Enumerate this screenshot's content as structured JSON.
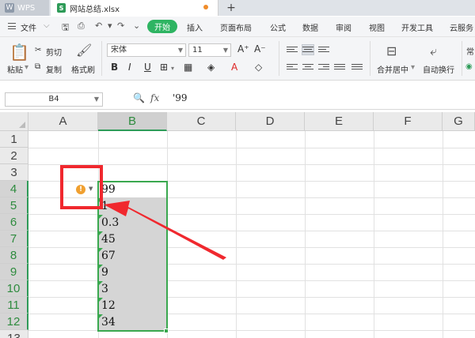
{
  "tabs": {
    "app_name": "WPS",
    "file_name": "网站总结.xlsx",
    "add": "+"
  },
  "menu": {
    "file": "文件",
    "start": "开始",
    "items": [
      "插入",
      "页面布局",
      "公式",
      "数据",
      "审阅",
      "视图",
      "开发工具",
      "云服务"
    ]
  },
  "ribbon": {
    "paste": "粘贴",
    "cut": "剪切",
    "copy": "复制",
    "format_painter": "格式刷",
    "font_name": "宋体",
    "font_size": "11",
    "merge_center": "合并居中",
    "wrap_text": "自动换行",
    "more": "常"
  },
  "formula_bar": {
    "name_box": "B4",
    "fx": "fx",
    "value": "'99"
  },
  "columns": [
    "A",
    "B",
    "C",
    "D",
    "E",
    "F",
    "G"
  ],
  "rows": [
    "1",
    "2",
    "3",
    "4",
    "5",
    "6",
    "7",
    "8",
    "9",
    "10",
    "11",
    "12",
    "13"
  ],
  "cells": {
    "B4": "99",
    "B5": "1",
    "B6": "0.3",
    "B7": "45",
    "B8": "67",
    "B9": "9",
    "B10": "3",
    "B11": "12",
    "B12": "34"
  },
  "colors": {
    "accent": "#2eb462",
    "selection": "#3aa84f",
    "annotation": "#f0282e",
    "warning": "#f0a030"
  }
}
